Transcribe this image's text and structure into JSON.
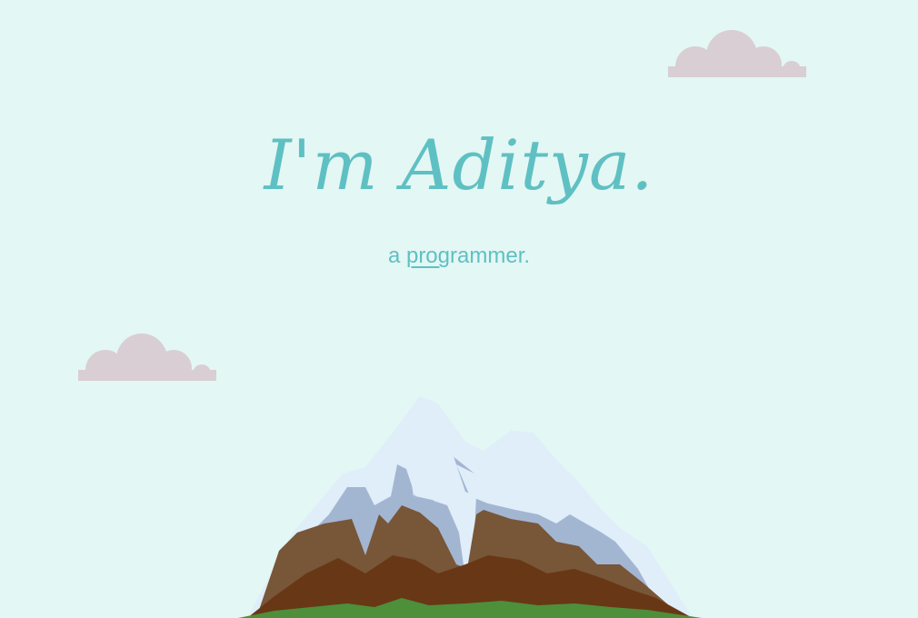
{
  "hero": {
    "title": "I'm Aditya.",
    "subtitle_prefix": "a ",
    "subtitle_typed": "prog",
    "subtitle_rest": "rammer."
  },
  "colors": {
    "background": "#e3f7f4",
    "text": "#5fc0c3",
    "cloud": "#d9ced3",
    "snow": "#e0eefa",
    "snow_shadow": "#a3b6d1",
    "rock_light": "#785638",
    "rock_dark": "#683716",
    "grass": "#4d8f3a"
  },
  "decorations": {
    "cloud_icon": "cloud-icon",
    "mountain_icon": "mountain-icon"
  }
}
